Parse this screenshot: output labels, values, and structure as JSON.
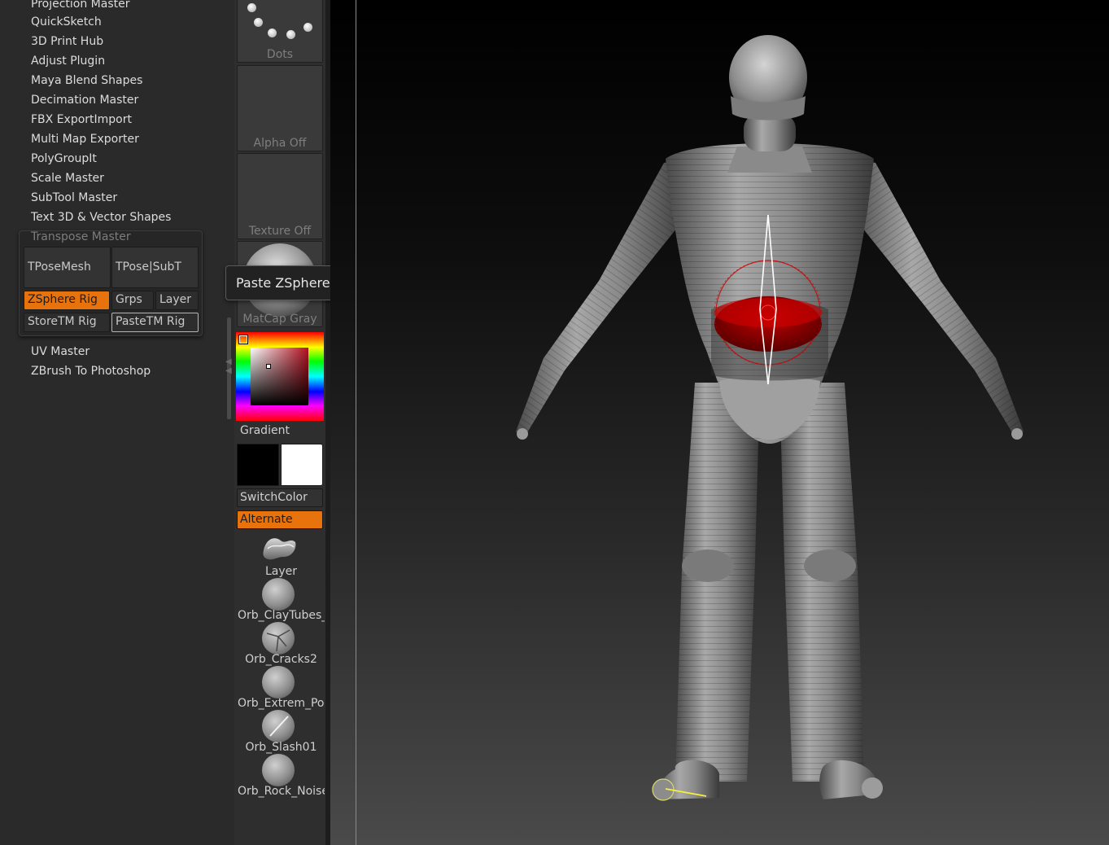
{
  "plugins": {
    "items": [
      "Projection Master",
      "QuickSketch",
      "3D Print Hub",
      "Adjust Plugin",
      "Maya Blend Shapes",
      "Decimation Master",
      "FBX ExportImport",
      "Multi Map Exporter",
      "PolyGroupIt",
      "Scale Master",
      "SubTool Master",
      "Text 3D & Vector Shapes"
    ],
    "transpose_master": {
      "title": "Transpose Master",
      "tpose_mesh": "TPoseMesh",
      "tpose_subt": "TPose|SubT",
      "zsphere_rig": "ZSphere Rig",
      "grps": "Grps",
      "layer": "Layer",
      "store_tm_rig": "StoreTM Rig",
      "paste_tm_rig": "PasteTM Rig"
    },
    "items_after": [
      "UV Master",
      "ZBrush To Photoshop"
    ]
  },
  "tools": {
    "stroke": "Dots",
    "alpha": "Alpha Off",
    "texture": "Texture Off",
    "material": "MatCap Gray",
    "gradient": "Gradient",
    "switch_color": "SwitchColor",
    "alternate": "Alternate",
    "brushes": [
      "Layer",
      "Orb_ClayTubes_",
      "Orb_Cracks2",
      "Orb_Extrem_Pol",
      "Orb_Slash01",
      "Orb_Rock_Noise"
    ]
  },
  "tooltip": "Paste ZSpheres Rig from memory",
  "colors": {
    "accent": "#e8720c",
    "main_color": "#000000",
    "secondary_color": "#ffffff",
    "selection_red": "#c80000"
  }
}
